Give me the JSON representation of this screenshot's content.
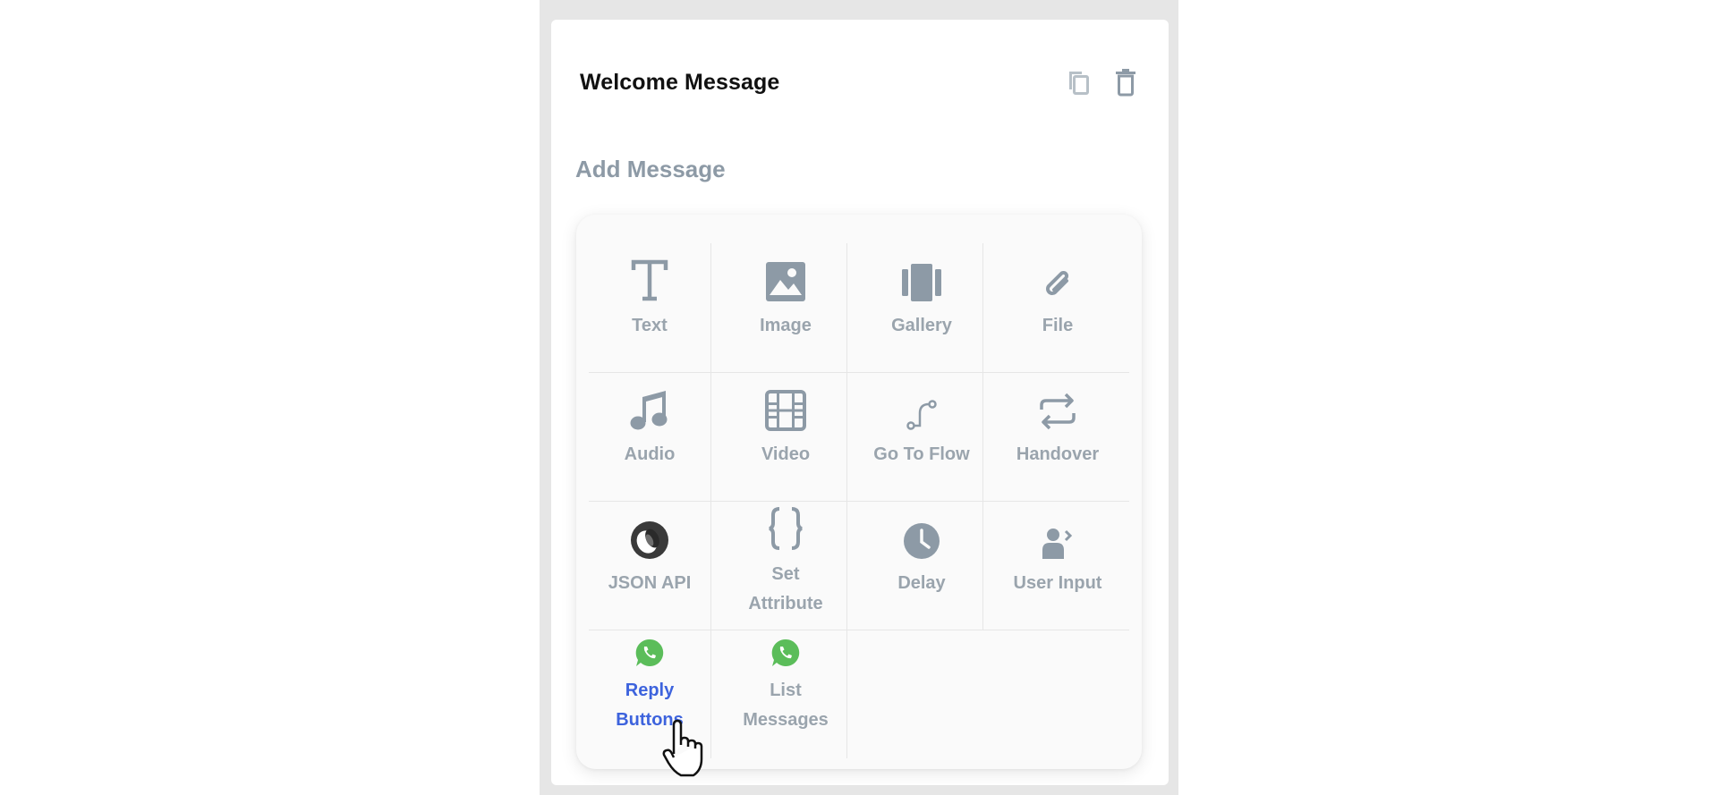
{
  "block": {
    "title": "Welcome Message",
    "section_title": "Add Message"
  },
  "message_types": [
    {
      "label": "Text",
      "icon": "text-icon"
    },
    {
      "label": "Image",
      "icon": "image-icon"
    },
    {
      "label": "Gallery",
      "icon": "gallery-icon"
    },
    {
      "label": "File",
      "icon": "paperclip-icon"
    },
    {
      "label": "Audio",
      "icon": "music-note-icon"
    },
    {
      "label": "Video",
      "icon": "film-icon"
    },
    {
      "label": "Go To Flow",
      "icon": "route-icon"
    },
    {
      "label": "Handover",
      "icon": "repeat-icon"
    },
    {
      "label": "JSON API",
      "icon": "json-logo-icon"
    },
    {
      "label": "Set\nAttribute",
      "icon": "curly-braces-icon"
    },
    {
      "label": "Delay",
      "icon": "clock-icon"
    },
    {
      "label": "User Input",
      "icon": "user-input-icon"
    },
    {
      "label": "Reply\nButtons",
      "icon": "whatsapp-icon",
      "state": "hover"
    },
    {
      "label": "List\nMessages",
      "icon": "whatsapp-icon"
    }
  ],
  "colors": {
    "icon_gray": "#8d9aa6",
    "label_gray": "#9aa4ad",
    "active_blue": "#3d63dd",
    "whatsapp_green": "#5bbd5a"
  }
}
